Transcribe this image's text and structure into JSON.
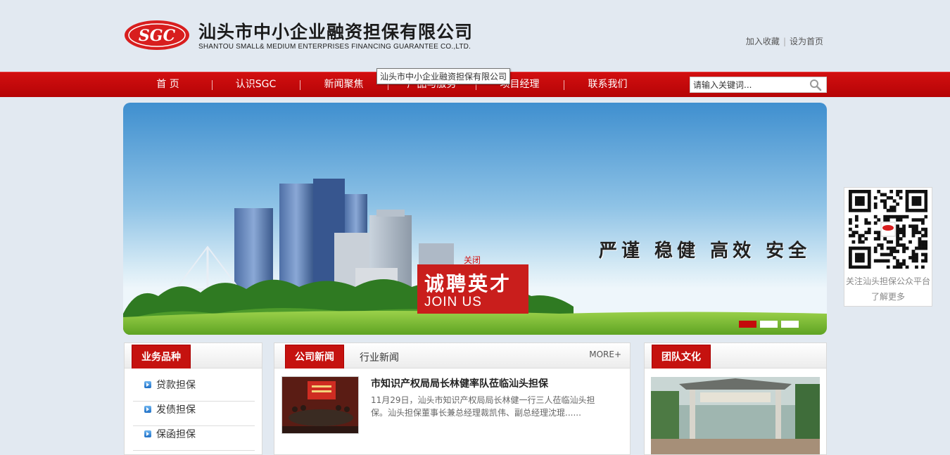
{
  "header": {
    "logo_text": "SGC",
    "company_cn": "汕头市中小企业融资担保有限公司",
    "company_en": "SHANTOU SMALL& MEDIUM ENTERPRISES FINANCING GUARANTEE CO.,LTD.",
    "links": [
      "加入收藏",
      "设为首页"
    ],
    "link_separator": "|"
  },
  "nav": {
    "items": [
      "首 页",
      "认识SGC",
      "新闻聚焦",
      "产品与服务",
      "项目经理",
      "联系我们"
    ],
    "search_placeholder": "请输入关键词...",
    "tooltip": "汕头市中小企业融资担保有限公司"
  },
  "banner": {
    "slogan": "严谨 稳健 高效 安全",
    "slides": 3,
    "active_slide": 1
  },
  "recruit": {
    "close_label": "关闭",
    "title_cn": "诚聘英才",
    "title_en": "JOIN US"
  },
  "qr": {
    "caption": "关注汕头担保公众平台",
    "more": "了解更多"
  },
  "business": {
    "tab": "业务品种",
    "items": [
      "贷款担保",
      "发债担保",
      "保函担保"
    ]
  },
  "news": {
    "tab_active": "公司新闻",
    "tab_other": "行业新闻",
    "more": "MORE+",
    "title": "市知识产权局局长林健率队莅临汕头担保",
    "summary": "11月29日，汕头市知识产权局局长林健一行三人莅临汕头担保。汕头担保董事长兼总经理裁凯伟、副总经理沈琨......"
  },
  "team": {
    "tab": "团队文化"
  },
  "colors": {
    "brand_red": "#c5120f",
    "page_bg": "#e2e9f1"
  }
}
